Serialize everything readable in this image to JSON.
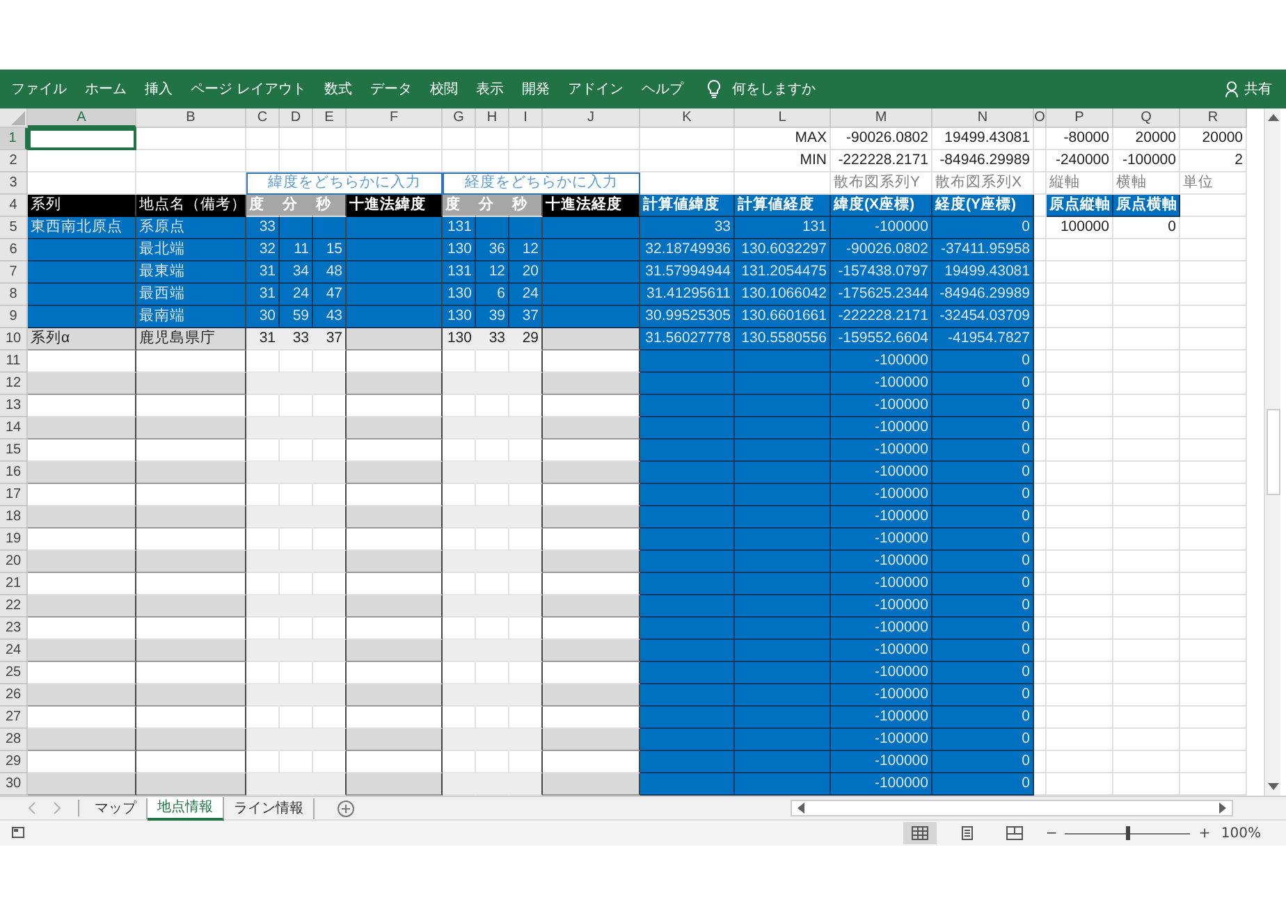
{
  "ribbon": {
    "tabs": [
      "ファイル",
      "ホーム",
      "挿入",
      "ページ レイアウト",
      "数式",
      "データ",
      "校閲",
      "表示",
      "開発",
      "アドイン",
      "ヘルプ"
    ],
    "tell_me": "何をしますか",
    "share": "共有"
  },
  "columns": [
    {
      "label": "A",
      "selected": true
    },
    {
      "label": "B",
      "selected": false
    },
    {
      "label": "C",
      "selected": false
    },
    {
      "label": "D",
      "selected": false
    },
    {
      "label": "E",
      "selected": false
    },
    {
      "label": "F",
      "selected": false
    },
    {
      "label": "G",
      "selected": false
    },
    {
      "label": "H",
      "selected": false
    },
    {
      "label": "I",
      "selected": false
    },
    {
      "label": "J",
      "selected": false
    },
    {
      "label": "K",
      "selected": false
    },
    {
      "label": "L",
      "selected": false
    },
    {
      "label": "M",
      "selected": false
    },
    {
      "label": "N",
      "selected": false
    },
    {
      "label": "O",
      "selected": false
    },
    {
      "label": "P",
      "selected": false
    },
    {
      "label": "Q",
      "selected": false
    },
    {
      "label": "R",
      "selected": false
    }
  ],
  "rows": [
    {
      "num": "1",
      "kind": "plain",
      "selected": true,
      "cells": {
        "L": "MAX",
        "M": "-90026.0802",
        "N": "19499.43081",
        "P": "-80000",
        "Q": "20000",
        "R": "20000"
      }
    },
    {
      "num": "2",
      "kind": "plain",
      "selected": false,
      "cells": {
        "L": "MIN",
        "M": "-222228.2171",
        "N": "-84946.29989",
        "P": "-240000",
        "Q": "-100000",
        "R": "2"
      }
    },
    {
      "num": "3",
      "kind": "caption",
      "selected": false,
      "cells": {
        "C": "緯度をどちらかに入力",
        "G": "経度をどちらかに入力",
        "M": "散布図系列Y",
        "N": "散布図系列X",
        "P": "縦軸",
        "Q": "横軸",
        "R": "単位"
      }
    },
    {
      "num": "4",
      "kind": "header",
      "selected": false,
      "cells": {
        "A": "系列",
        "B": "地点名（備考）",
        "C": "度",
        "D": "分",
        "E": "秒",
        "F": "十進法緯度",
        "G": "度",
        "H": "分",
        "I": "秒",
        "J": "十進法経度",
        "K": "計算値緯度",
        "L": "計算値経度",
        "M": "緯度(X座標)",
        "N": "経度(Y座標)",
        "P": "原点縦軸",
        "Q": "原点横軸"
      }
    },
    {
      "num": "5",
      "kind": "series",
      "selected": false,
      "cells": {
        "A": "東西南北原点",
        "B": "系原点",
        "C": "33",
        "G": "131",
        "K": "33",
        "L": "131",
        "M": "-100000",
        "N": "0",
        "P": "100000",
        "Q": "0"
      }
    },
    {
      "num": "6",
      "kind": "series",
      "selected": false,
      "cells": {
        "B": "最北端",
        "C": "32",
        "D": "11",
        "E": "15",
        "G": "130",
        "H": "36",
        "I": "12",
        "K": "32.18749936",
        "L": "130.6032297",
        "M": "-90026.0802",
        "N": "-37411.95958"
      }
    },
    {
      "num": "7",
      "kind": "series",
      "selected": false,
      "cells": {
        "B": "最東端",
        "C": "31",
        "D": "34",
        "E": "48",
        "G": "131",
        "H": "12",
        "I": "20",
        "K": "31.57994944",
        "L": "131.2054475",
        "M": "-157438.0797",
        "N": "19499.43081"
      }
    },
    {
      "num": "8",
      "kind": "series",
      "selected": false,
      "cells": {
        "B": "最西端",
        "C": "31",
        "D": "24",
        "E": "47",
        "G": "130",
        "H": "6",
        "I": "24",
        "K": "31.41295611",
        "L": "130.1066042",
        "M": "-175625.2344",
        "N": "-84946.29989"
      }
    },
    {
      "num": "9",
      "kind": "series",
      "selected": false,
      "cells": {
        "B": "最南端",
        "C": "30",
        "D": "59",
        "E": "43",
        "G": "130",
        "H": "39",
        "I": "37",
        "K": "30.99525305",
        "L": "130.6601661",
        "M": "-222228.2171",
        "N": "-32454.03709"
      }
    },
    {
      "num": "10",
      "kind": "band",
      "selected": false,
      "cells": {
        "A": "系列α",
        "B": "鹿児島県庁",
        "C": "31",
        "D": "33",
        "E": "37",
        "G": "130",
        "H": "33",
        "I": "29",
        "K": "31.56027778",
        "L": "130.5580556",
        "M": "-159552.6604",
        "N": "-41954.7827"
      }
    },
    {
      "num": "11",
      "kind": "plainrow",
      "selected": false,
      "cells": {
        "M": "-100000",
        "N": "0"
      }
    },
    {
      "num": "12",
      "kind": "band",
      "selected": false,
      "cells": {
        "M": "-100000",
        "N": "0"
      }
    },
    {
      "num": "13",
      "kind": "plainrow",
      "selected": false,
      "cells": {
        "M": "-100000",
        "N": "0"
      }
    },
    {
      "num": "14",
      "kind": "band",
      "selected": false,
      "cells": {
        "M": "-100000",
        "N": "0"
      }
    },
    {
      "num": "15",
      "kind": "plainrow",
      "selected": false,
      "cells": {
        "M": "-100000",
        "N": "0"
      }
    },
    {
      "num": "16",
      "kind": "band",
      "selected": false,
      "cells": {
        "M": "-100000",
        "N": "0"
      }
    },
    {
      "num": "17",
      "kind": "plainrow",
      "selected": false,
      "cells": {
        "M": "-100000",
        "N": "0"
      }
    },
    {
      "num": "18",
      "kind": "band",
      "selected": false,
      "cells": {
        "M": "-100000",
        "N": "0"
      }
    },
    {
      "num": "19",
      "kind": "plainrow",
      "selected": false,
      "cells": {
        "M": "-100000",
        "N": "0"
      }
    },
    {
      "num": "20",
      "kind": "band",
      "selected": false,
      "cells": {
        "M": "-100000",
        "N": "0"
      }
    },
    {
      "num": "21",
      "kind": "plainrow",
      "selected": false,
      "cells": {
        "M": "-100000",
        "N": "0"
      }
    },
    {
      "num": "22",
      "kind": "band",
      "selected": false,
      "cells": {
        "M": "-100000",
        "N": "0"
      }
    },
    {
      "num": "23",
      "kind": "plainrow",
      "selected": false,
      "cells": {
        "M": "-100000",
        "N": "0"
      }
    },
    {
      "num": "24",
      "kind": "band",
      "selected": false,
      "cells": {
        "M": "-100000",
        "N": "0"
      }
    },
    {
      "num": "25",
      "kind": "plainrow",
      "selected": false,
      "cells": {
        "M": "-100000",
        "N": "0"
      }
    },
    {
      "num": "26",
      "kind": "band",
      "selected": false,
      "cells": {
        "M": "-100000",
        "N": "0"
      }
    },
    {
      "num": "27",
      "kind": "plainrow",
      "selected": false,
      "cells": {
        "M": "-100000",
        "N": "0"
      }
    },
    {
      "num": "28",
      "kind": "band",
      "selected": false,
      "cells": {
        "M": "-100000",
        "N": "0"
      }
    },
    {
      "num": "29",
      "kind": "plainrow",
      "selected": false,
      "cells": {
        "M": "-100000",
        "N": "0"
      }
    },
    {
      "num": "30",
      "kind": "band",
      "selected": false,
      "cells": {
        "M": "-100000",
        "N": "0"
      }
    }
  ],
  "sheet_tabs": [
    {
      "label": "マップ",
      "selected": false
    },
    {
      "label": "地点情報",
      "selected": true
    },
    {
      "label": "ライン情報",
      "selected": false
    }
  ],
  "status_bar": {
    "views": [
      {
        "kind": "normal",
        "selected": true
      },
      {
        "kind": "page_layout",
        "selected": false
      },
      {
        "kind": "page_break",
        "selected": false
      }
    ],
    "zoom_out": "−",
    "zoom_in": "+",
    "zoom": {
      "level": 0.5,
      "label": "100%"
    }
  }
}
